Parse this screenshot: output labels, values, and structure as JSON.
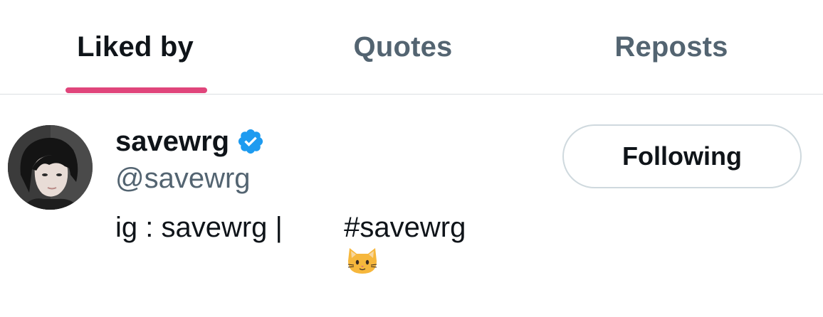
{
  "tabs": [
    {
      "label": "Liked by",
      "active": true
    },
    {
      "label": "Quotes",
      "active": false
    },
    {
      "label": "Reposts",
      "active": false
    }
  ],
  "colors": {
    "accent_underline": "#e0457b",
    "verified_badge": "#1d9bf0",
    "secondary_text": "#536471",
    "primary_text": "#0f1419",
    "divider": "#dcdfe2",
    "button_border": "#cfd9de"
  },
  "user": {
    "display_name": "savewrg",
    "handle": "@savewrg",
    "verified": true,
    "verified_icon": "verified-badge-icon",
    "bio_prefix": "ig : savewrg | ",
    "bio_emoji": "cat-face-icon",
    "bio_suffix": " #savewrg",
    "avatar": "user-avatar"
  },
  "follow_button": {
    "label": "Following"
  }
}
